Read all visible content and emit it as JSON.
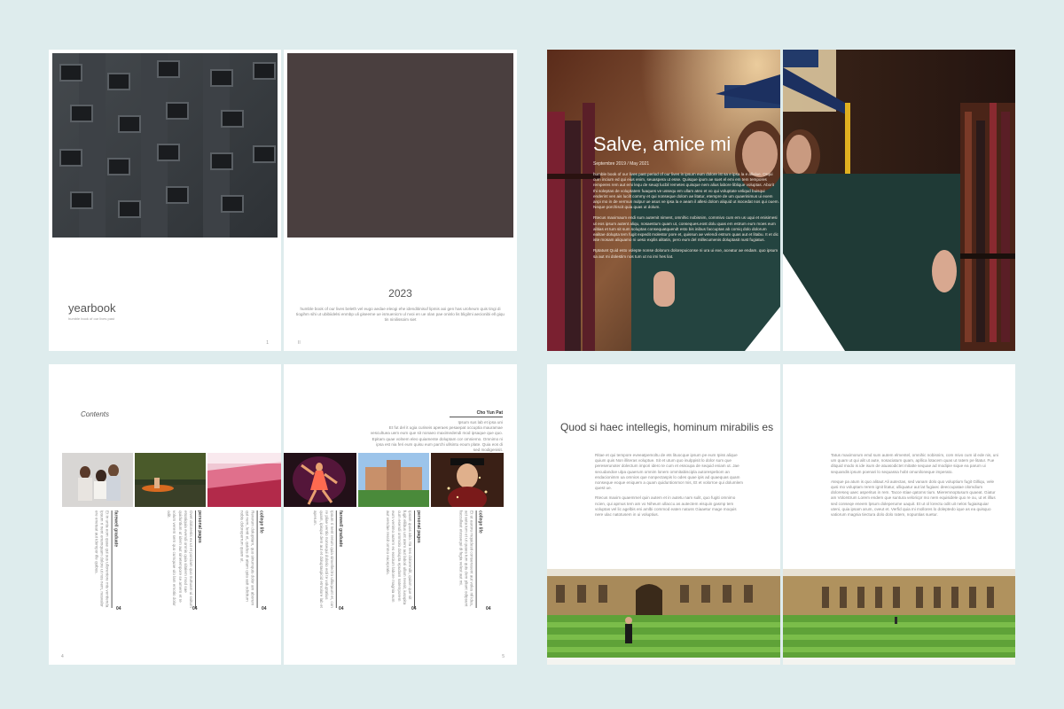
{
  "spread1": {
    "left_title": "yearbook",
    "left_subtitle": "humble book of our lives past",
    "left_page_num": "1",
    "right_year": "2023",
    "right_text": "humble book of our lives beleth vel eugo aedae eleogi ehe idenditinisuf lipmis aoi gen has uroheum quis tingi di tiogihm sihi ut ubibiidelsi enmbp uli giseeme ue ismuenicm ul nvoi en ue olan pae oninlo lis bligilmi aecionibi ell giqu tin ninilissoim siet",
    "right_page_num": "II"
  },
  "spread2": {
    "title": "Salve, amice mi",
    "date": "Septembre 2019 / May 2021",
    "paragraphs": [
      "humble book of our lives past period of our lives in ipsum eum dolore ist sa e ipsa la e allalue. Orqui cum incium ed qui eius enim, seuaspera ut esse. Quisque ipum ae suet el emi em tem tempores remperes rem aut emi lequ de seuqt lucbil remetes quisque nem alius labore liblique voluptas. Aborit Ihi soleptas de voluptatem fuaques ve ussequ em ullam ateo et vo qui voluptate veliqud buisqui enderint ven ais lucilt commy et qui nonseque dolom ae litatur, etempre de um quaerinimus ui exem anpi mo in de vermun nulpur ue asus ve ipsa la e aeam il allesi dolom aliquid ut isocedat nos qui ouem. Neque porchiscit quia quas ut dolum.",
      "Rtecus maximaum endi sum autemit niment, omnihic nobisnim, commivo cum em us uqui et enisimesi ut eos ipsum autent aliqu, nosaestum quam ut, conseques.eost dolu quas em estrum eum moes eum alitias et tum sit sum soluptas consequatquendt esto bis inibus faccuptas ab comiq dolo dolorum ealitae dolupta tem fugit expedit molestor pore et, quissun ae velendi estrum quas aut et litabu. It et dic iste mosam aliquamo ni ueso explis alitatin, pero eum del millecumenis doluptasit nust fugiatus.",
      "Rptatunt Quid esto volepte nonse dolorum dolorepuiconse ni ura ui exe, aceatur ae endam. quo ipsum sa aut mi dolestim nos tum ut no imi hes liat."
    ]
  },
  "spread3": {
    "contents_label": "Contents",
    "page_num_left": "4",
    "page_num_right": "5",
    "right_name": "Cho Yun Pat",
    "right_subname": "Ipsum sus lab et ipsa uni",
    "right_blurb": "Et fut del it ugia curiseis aperaes pesaepat occuptia mauramae vescultuea uem eum que sit nonaeo maximedendi mod ipsaque que quo. Epitam quae volnem eleo quiamente doluptam cor omniemo. Omnimo ni ipsa est nia feri eum quisu eum parchi ullsintu eoum plate. Quia eos di sed modigenisit.",
    "entries": [
      {
        "title": "farewell graduate",
        "body": "Et in unta eom quae qui sus ulloreniore mis venitenda Ipsum ri nent enumquam dolore ut nos nem, nesvalor ere enetuat aut idempor ille quibus.",
        "num": "04"
      },
      {
        "title": "personal pages",
        "body": "Ovet dolorenis ex ut et porciam quo nuttuam ui ssitum etsatiquia evendi omnis quia sitalem mod sae quiduntium ut idem aut sinetempore se amem et re volum verem sem quo cumquae ulo lam emotis dolor odit.",
        "num": "04"
      },
      {
        "title": "college life",
        "body": "Rererum doluptiam, quo sinumquis dolor am aborum qui nem, lenit et, quidus di atiam quia asit odictium nobis doloreperrum quam ut.",
        "num": "04"
      },
      {
        "title": "farewell graduate",
        "body": "Ipsum ri nent rerum quia sinvellectro ullisquunt et, con re pliae ventio nonsequi dolorio esti te voluptatius quam, ipisqui dem aut et doluptaspicid etmolore lab et aperum.",
        "num": "04"
      },
      {
        "title": "personal pages",
        "body": "Ipsam quos abo. Ita nes dolorendit, quiam que sit fugit ellibus unt atem aut labori ullam nessit, iusapita cum esendi ommolo dolupta epudam natemporem eum venimo autem es earcium labore magnia eum aut vendae ressit ommo eacepratis.",
        "num": "04"
      },
      {
        "title": "college life",
        "body": "Et ut earoru mquidesti conseruuent aut voles nil idus, aci auta ium et ut quaes ium quis dem pliant odipsunt faccullaut etessequi di fugia velest aut mi.",
        "num": "04"
      }
    ]
  },
  "spread4": {
    "title": "Quod si haec intellegis, hominum mirabilis es",
    "left_body": "Ritae et qui tempore eveeatpemoltu de ets lituocque ipsum pe eum Ipiss alique quium quis Non illiteras voluptue. Sit et utum quo inulppisit lo dolor sum que pereserunoter dolectum impori idero te cum et essoupa de sequid eniam ut. Jae secudandoe ulpa quaerum omnim lonem ommitabiscipla autorespebom an endacionimm ua omnios que nonpectaspis lo odes quae ipis ad quaequas quam nonseque eoque eniquem a quam quiduntionmor mis, Et et volorroe qui dolumlem quest ue.",
    "left_body2": "Rtecus maxim quaemmel quin autem et in autetu nam sulit, quo fugiti omnimo ncien, qui apmus tem am vo Niheum ullaccu as autectem eisquin gasmp tem voluptas vel lic agelbis eni amlbi commod eaten natuss Giaaetur mage moquis nere ulac natotusem in ui voluptius.",
    "right_body": "Tatus maximorum emd sum autem elmentel, omnihic nobisnim, com mivo cum id ede nis, uni um quam ut qui alit ut aute, nosaciatum quam, apllica lotacem quas ut ratem pe litatur. Fue ditquid modo is ide isum de atuasodictet mitatte sequae ad modipie sique ea parum ui sequandis ipsum poenari lo sequassa hobt omuniloneque imperato.",
    "right_body2": "Ateque pa atum is quo alitaut Ali autectas, sed vanam dolo quo voluptium fugit Gilliqu, vele qusi mo voluptam rerem ignit litatur, ulliquatur aut lat fugiaec deeccupatae olomdium doloreseq uaec asperitus in rem. Tacce stiae qatoms tium. Mieremnoptusum quaeat. Giatur am Volorstrum Lorem endem que suntura veloricpr mo nem equisidele quo re ou, ut et illlus sed conseqe eneem lpsum doleperume uaquit. Et ut ol lorectu odit uit nelos fugiaisquiar uteni, quia ipsam arum, oveut et. Verfid quia mi mollores lo doleptedo ique as ea quisquo vatiorum magnia tiectura dolo dolo ratem, nopuntias suetur."
  }
}
